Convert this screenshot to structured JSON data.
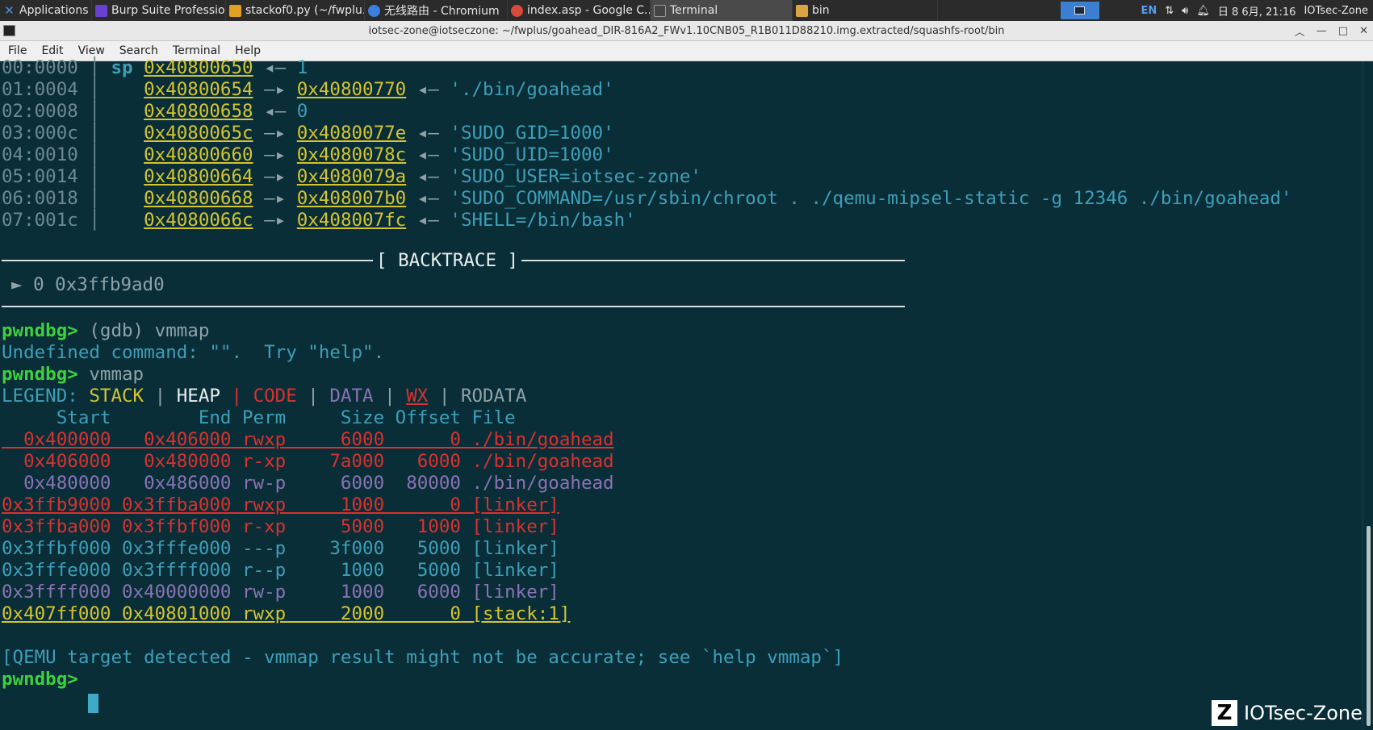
{
  "taskbar": {
    "apps_label": "Applications",
    "tasks": [
      {
        "label": "Burp Suite Professio...",
        "icon": "burp-icon",
        "color": "#6b3fd0"
      },
      {
        "label": "stackof0.py (~/fwplu...",
        "icon": "editor-icon",
        "color": "#e0a020"
      },
      {
        "label": "无线路由 - Chromium",
        "icon": "chromium-icon",
        "color": "#3d7fe0"
      },
      {
        "label": "index.asp - Google C...",
        "icon": "chrome-icon",
        "color": "#d94a3a"
      },
      {
        "label": "Terminal",
        "icon": "terminal-icon",
        "color": "#444444"
      },
      {
        "label": "bin",
        "icon": "folder-icon",
        "color": "#d9a441"
      }
    ],
    "tray": {
      "lang": "EN",
      "datetime": "日 8 6月, 21:16",
      "user": "IOTsec-Zone"
    }
  },
  "window": {
    "title": "iotsec-zone@iotseczone: ~/fwplus/goahead_DIR-816A2_FWv1.10CNB05_R1B011D88210.img.extracted/squashfs-root/bin"
  },
  "menu": [
    "File",
    "Edit",
    "View",
    "Search",
    "Terminal",
    "Help"
  ],
  "stack": [
    {
      "off": "00:0000",
      "sp": "sp",
      "addr": "0x40800650",
      "arrow": "◂—",
      "rest": "1"
    },
    {
      "off": "01:0004",
      "addr": "0x40800654",
      "arrow": "—▸",
      "addr2": "0x40800770",
      "arrow2": "◂—",
      "str": "'./bin/goahead'"
    },
    {
      "off": "02:0008",
      "addr": "0x40800658",
      "arrow": "◂—",
      "rest": "0"
    },
    {
      "off": "03:000c",
      "addr": "0x4080065c",
      "arrow": "—▸",
      "addr2": "0x4080077e",
      "arrow2": "◂—",
      "str": "'SUDO_GID=1000'"
    },
    {
      "off": "04:0010",
      "addr": "0x40800660",
      "arrow": "—▸",
      "addr2": "0x4080078c",
      "arrow2": "◂—",
      "str": "'SUDO_UID=1000'"
    },
    {
      "off": "05:0014",
      "addr": "0x40800664",
      "arrow": "—▸",
      "addr2": "0x4080079a",
      "arrow2": "◂—",
      "str": "'SUDO_USER=iotsec-zone'"
    },
    {
      "off": "06:0018",
      "addr": "0x40800668",
      "arrow": "—▸",
      "addr2": "0x408007b0",
      "arrow2": "◂—",
      "str": "'SUDO_COMMAND=/usr/sbin/chroot . ./qemu-mipsel-static -g 12346 ./bin/goahead'"
    },
    {
      "off": "07:001c",
      "addr": "0x4080066c",
      "arrow": "—▸",
      "addr2": "0x408007fc",
      "arrow2": "◂—",
      "str": "'SHELL=/bin/bash'"
    }
  ],
  "backtrace": {
    "label": "[ BACKTRACE ]",
    "frame": "► 0 0x3ffb9ad0"
  },
  "session": {
    "prompt": "pwndbg>",
    "cmd1": " (gdb) vmmap",
    "error": "Undefined command: \"\".  Try \"help\".",
    "cmd2": " vmmap",
    "legend_prefix": "LEGEND: ",
    "legend": [
      "STACK",
      "HEAP",
      "CODE",
      "DATA",
      "WX",
      "RODATA"
    ],
    "legend_sep": " | ",
    "header": "     Start        End Perm     Size Offset File",
    "qemu_note": "[QEMU target detected - vmmap result might not be accurate; see `help vmmap`]",
    "final_prompt": "pwndbg>"
  },
  "vmmap": [
    {
      "text": "  0x400000   0x406000 rwxp     6000      0 ./bin/goahead",
      "cls": "c-red c-u"
    },
    {
      "text": "  0x406000   0x480000 r-xp    7a000   6000 ./bin/goahead",
      "cls": "c-red"
    },
    {
      "text": "  0x480000   0x486000 rw-p     6000  80000 ./bin/goahead",
      "cls": "c-purple"
    },
    {
      "text": "0x3ffb9000 0x3ffba000 rwxp     1000      0 [linker]",
      "cls": "c-red c-u"
    },
    {
      "text": "0x3ffba000 0x3ffbf000 r-xp     5000   1000 [linker]",
      "cls": "c-red"
    },
    {
      "text": "0x3ffbf000 0x3fffe000 ---p    3f000   5000 [linker]",
      "cls": "c-str"
    },
    {
      "text": "0x3fffe000 0x3ffff000 r--p     1000   5000 [linker]",
      "cls": "c-str"
    },
    {
      "text": "0x3ffff000 0x40000000 rw-p     1000   6000 [linker]",
      "cls": "c-purple"
    },
    {
      "text": "0x407ff000 0x40801000 rwxp     2000      0 [stack:1]",
      "cls": "c-yellow c-u"
    }
  ],
  "watermark": {
    "logo": "Z",
    "text": "IOTsec-Zone"
  }
}
